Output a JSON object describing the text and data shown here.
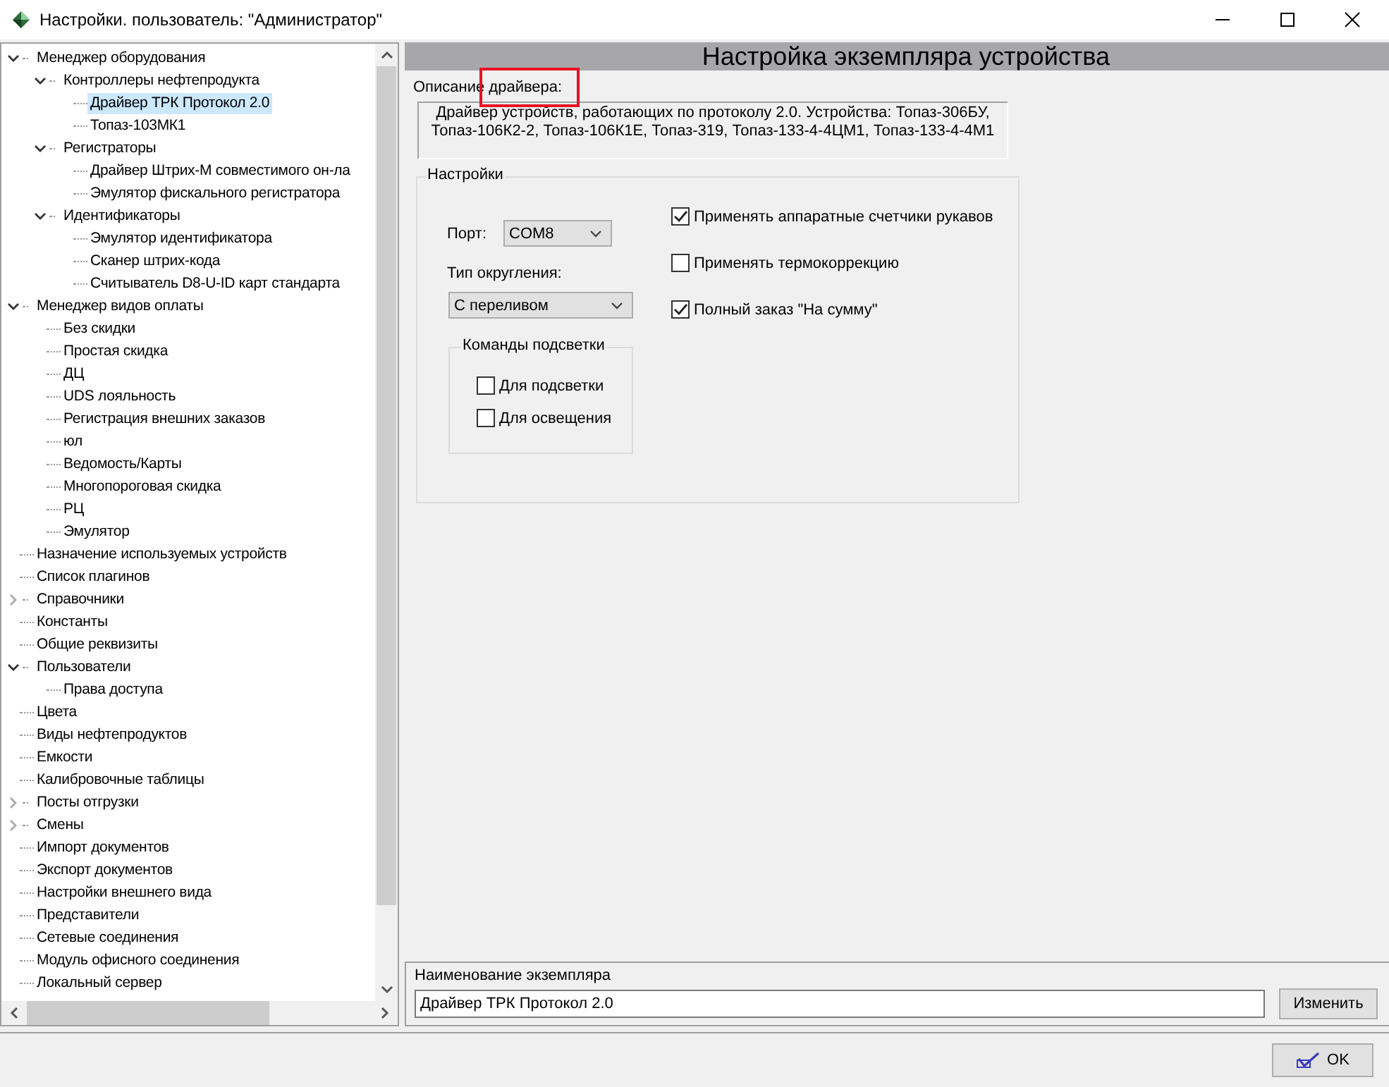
{
  "window": {
    "title": "Настройки. пользователь: \"Администратор\""
  },
  "tree": [
    {
      "label": "Менеджер оборудования",
      "expanded": true,
      "selected": false,
      "children": [
        {
          "label": "Контроллеры нефтепродукта",
          "expanded": true,
          "selected": false,
          "children": [
            {
              "label": "Драйвер ТРК Протокол 2.0",
              "selected": true
            },
            {
              "label": "Топаз-103МК1",
              "selected": false
            }
          ]
        },
        {
          "label": "Регистраторы",
          "expanded": true,
          "selected": false,
          "children": [
            {
              "label": "Драйвер Штрих-М совместимого он-ла",
              "selected": false
            },
            {
              "label": "Эмулятор фискального регистратора",
              "selected": false
            }
          ]
        },
        {
          "label": "Идентификаторы",
          "expanded": true,
          "selected": false,
          "children": [
            {
              "label": "Эмулятор идентификатора",
              "selected": false
            },
            {
              "label": "Сканер штрих-кода",
              "selected": false
            },
            {
              "label": "Считыватель D8-U-ID карт стандарта",
              "selected": false
            }
          ]
        }
      ]
    },
    {
      "label": "Менеджер видов оплаты",
      "expanded": true,
      "selected": false,
      "children": [
        {
          "label": "Без скидки",
          "selected": false
        },
        {
          "label": "Простая скидка",
          "selected": false
        },
        {
          "label": "ДЦ",
          "selected": false
        },
        {
          "label": "UDS лояльность",
          "selected": false
        },
        {
          "label": "Регистрация внешних заказов",
          "selected": false
        },
        {
          "label": "юл",
          "selected": false
        },
        {
          "label": "Ведомость/Карты",
          "selected": false
        },
        {
          "label": "Многопороговая скидка",
          "selected": false
        },
        {
          "label": "РЦ",
          "selected": false
        },
        {
          "label": "Эмулятор",
          "selected": false
        }
      ]
    },
    {
      "label": "Назначение используемых устройств",
      "selected": false
    },
    {
      "label": "Список плагинов",
      "selected": false
    },
    {
      "label": "Справочники",
      "expanded": false,
      "selected": false
    },
    {
      "label": "Константы",
      "selected": false
    },
    {
      "label": "Общие реквизиты",
      "selected": false
    },
    {
      "label": "Пользователи",
      "expanded": true,
      "selected": false,
      "children": [
        {
          "label": "Права доступа",
          "selected": false
        }
      ]
    },
    {
      "label": "Цвета",
      "selected": false
    },
    {
      "label": "Виды нефтепродуктов",
      "selected": false
    },
    {
      "label": "Емкости",
      "selected": false
    },
    {
      "label": "Калибровочные таблицы",
      "selected": false
    },
    {
      "label": "Посты отгрузки",
      "expanded": false,
      "selected": false
    },
    {
      "label": "Смены",
      "expanded": false,
      "selected": false
    },
    {
      "label": "Импорт документов",
      "selected": false
    },
    {
      "label": "Экспорт документов",
      "selected": false
    },
    {
      "label": "Настройки внешнего вида",
      "selected": false
    },
    {
      "label": "Представители",
      "selected": false
    },
    {
      "label": "Сетевые соединения",
      "selected": false
    },
    {
      "label": "Модуль офисного соединения",
      "selected": false
    },
    {
      "label": "Локальный сервер",
      "selected": false
    }
  ],
  "panel": {
    "header": "Настройка экземпляра устройства",
    "description_label": "Описание драйвера:",
    "description": "Драйвер устройств, работающих по протоколу 2.0. Устройства: Топаз-306БУ, Топаз-106К2-2, Топаз-106К1Е, Топаз-319, Топаз-133-4-4ЦМ1, Топаз-133-4-4М1",
    "settings": {
      "title": "Настройки",
      "port": {
        "label": "Порт:",
        "value": "COM8"
      },
      "rounding": {
        "label": "Тип округления:",
        "value": "С переливом"
      },
      "backlight": {
        "title": "Команды подсветки",
        "options": [
          {
            "label": "Для подсветки",
            "checked": false
          },
          {
            "label": "Для освещения",
            "checked": false
          }
        ]
      },
      "options": [
        {
          "label": "Применять аппаратные счетчики рукавов",
          "checked": true
        },
        {
          "label": "Применять термокоррекцию",
          "checked": false
        },
        {
          "label": "Полный заказ \"На сумму\"",
          "checked": true
        }
      ]
    },
    "instance": {
      "label": "Наименование экземпляра",
      "value": "Драйвер ТРК Протокол 2.0",
      "button": "Изменить"
    }
  },
  "ok_button": "OK"
}
